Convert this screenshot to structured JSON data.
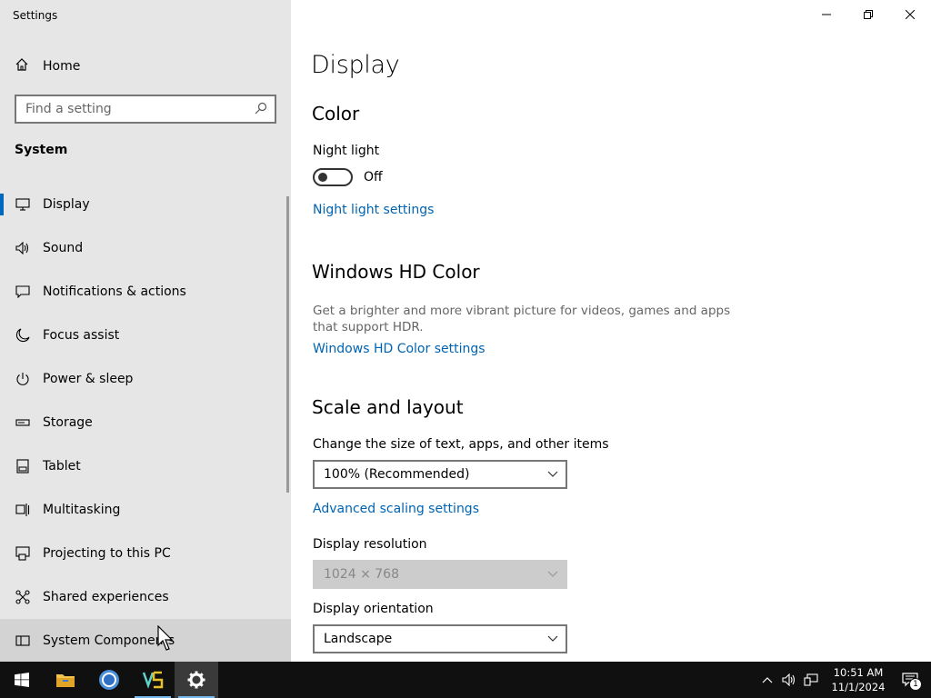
{
  "app": {
    "title": "Settings"
  },
  "sidebar": {
    "home_label": "Home",
    "search_placeholder": "Find a setting",
    "section_title": "System",
    "items": [
      {
        "label": "Display",
        "icon": "monitor-icon"
      },
      {
        "label": "Sound",
        "icon": "speaker-icon"
      },
      {
        "label": "Notifications & actions",
        "icon": "notification-icon"
      },
      {
        "label": "Focus assist",
        "icon": "moon-icon"
      },
      {
        "label": "Power & sleep",
        "icon": "power-icon"
      },
      {
        "label": "Storage",
        "icon": "storage-icon"
      },
      {
        "label": "Tablet",
        "icon": "tablet-icon"
      },
      {
        "label": "Multitasking",
        "icon": "multitasking-icon"
      },
      {
        "label": "Projecting to this PC",
        "icon": "projecting-icon"
      },
      {
        "label": "Shared experiences",
        "icon": "shared-icon"
      },
      {
        "label": "System Components",
        "icon": "components-icon"
      }
    ]
  },
  "content": {
    "page_title": "Display",
    "color": {
      "heading": "Color",
      "night_light_label": "Night light",
      "night_light_state": "Off",
      "night_light_link": "Night light settings"
    },
    "hdr": {
      "heading": "Windows HD Color",
      "description": "Get a brighter and more vibrant picture for videos, games and apps that support HDR.",
      "link": "Windows HD Color settings"
    },
    "scale": {
      "heading": "Scale and layout",
      "size_label": "Change the size of text, apps, and other items",
      "size_value": "100% (Recommended)",
      "advanced_link": "Advanced scaling settings",
      "resolution_label": "Display resolution",
      "resolution_value": "1024 × 768",
      "orientation_label": "Display orientation",
      "orientation_value": "Landscape"
    }
  },
  "taskbar": {
    "apps": [
      "start-icon",
      "file-explorer-icon",
      "chrome-icon",
      "vs-app-icon",
      "settings-icon"
    ],
    "clock": {
      "time": "10:51 AM",
      "date": "11/1/2024"
    },
    "notification_count": "1"
  },
  "colors": {
    "accent": "#0067c0",
    "link": "#0063b1",
    "sidebar_bg": "#e6e6e6",
    "taskbar_bg": "#101010"
  }
}
